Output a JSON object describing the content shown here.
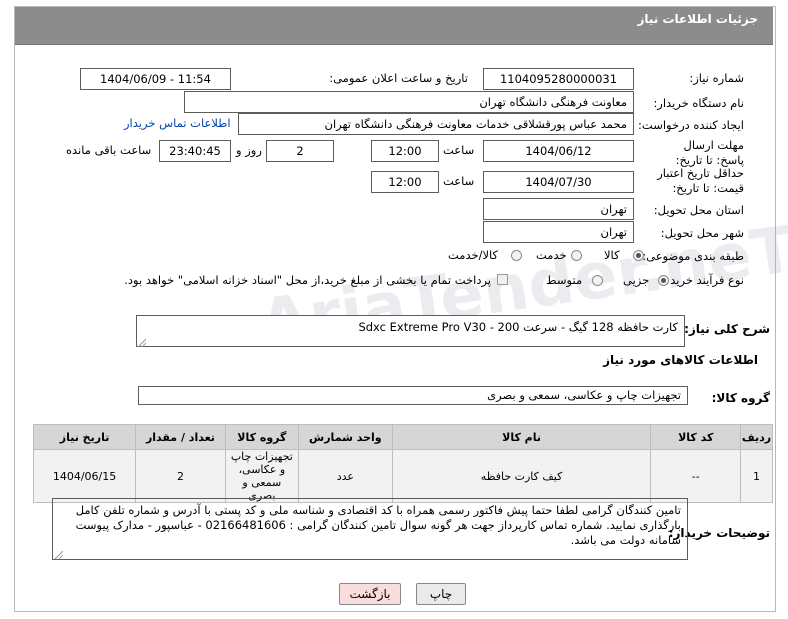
{
  "header": {
    "title": "جزئیات اطلاعات نیاز"
  },
  "fields": {
    "need_number_label": "شماره نیاز:",
    "need_number": "1104095280000031",
    "announce_label": "تاریخ و ساعت اعلان عمومی:",
    "announce_value": "1404/06/09 - 11:54",
    "buyer_org_label": "نام دستگاه خریدار:",
    "buyer_org": "معاونت فرهنگی دانشگاه تهران",
    "creator_label": "ایجاد کننده درخواست:",
    "creator": "محمد عباس پورقشلاقی خدمات معاونت فرهنگی دانشگاه تهران",
    "contact_link": "اطلاعات تماس خریدار",
    "deadline_label": "مهلت ارسال پاسخ: تا تاریخ:",
    "deadline_date": "1404/06/12",
    "time_label": "ساعت",
    "deadline_time": "12:00",
    "days_value": "2",
    "days_label": "روز و",
    "remaining_time": "23:40:45",
    "remaining_label": "ساعت باقی مانده",
    "price_validity_label": "حداقل تاریخ اعتبار قیمت: تا تاریخ:",
    "price_validity_date": "1404/07/30",
    "price_validity_time": "12:00",
    "province_label": "استان محل تحویل:",
    "province": "تهران",
    "city_label": "شهر محل تحویل:",
    "city": "تهران",
    "category_label": "طبقه بندی موضوعی:",
    "category_options": [
      "کالا",
      "خدمت",
      "کالا/خدمت"
    ],
    "category_selected": "کالا",
    "process_label": "نوع فرآیند خرید :",
    "process_options": [
      "جزیی",
      "متوسط"
    ],
    "process_selected": "جزیی",
    "payment_note": "پرداخت تمام یا بخشی از مبلغ خرید،از محل \"اسناد خزانه اسلامی\" خواهد بود."
  },
  "summary": {
    "label": "شرح کلی نیاز:",
    "text": "کارت حافظه 128 گیگ - سرعت Sdxc Extreme Pro V30 - 200"
  },
  "goods_info": {
    "title": "اطلاعات کالاهای مورد نیاز",
    "group_label": "گروه کالا:",
    "group_value": "تجهیزات چاپ و عکاسی، سمعی و بصری"
  },
  "table": {
    "headers": [
      "ردیف",
      "کد کالا",
      "نام کالا",
      "واحد شمارش",
      "گروه کالا",
      "تعداد / مقدار",
      "تاریخ نیاز"
    ],
    "rows": [
      {
        "row": "1",
        "code": "--",
        "name": "کیف کارت حافظه",
        "unit": "عدد",
        "group": "تجهیزات چاپ و عکاسی، سمعی و بصری",
        "qty": "2",
        "date": "1404/06/15"
      }
    ]
  },
  "buyer_notes": {
    "label": "توضیحات خریدار:",
    "text": "تامین کنندگان گرامی لطفا حتما پیش فاکتور رسمی همراه با کد اقتصادی و شناسه ملی و کد پستی با آدرس و شماره تلفن کامل بارگذاری نمایید. شماره تماس کارپرداز جهت هر گونه سوال تامین کنندگان گرامی : 02166481606 - عباسپور - مدارک پیوست سامانه دولت می باشد."
  },
  "buttons": {
    "print": "چاپ",
    "back": "بازگشت"
  },
  "colors": {
    "header_bg": "#8c8c8c",
    "link": "#0645ad",
    "back_button": "#f9dcdc",
    "print_button": "#eaeaea"
  }
}
